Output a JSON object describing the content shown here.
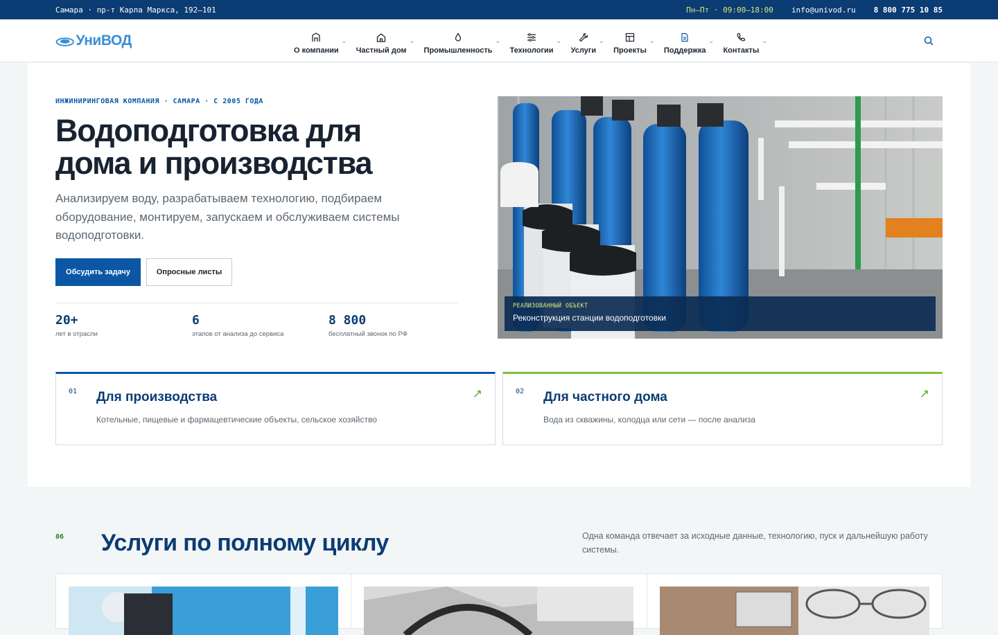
{
  "topbar": {
    "address": "Самара · пр-т Карла Маркса, 192–101",
    "hours": "Пн–Пт · 09:00–18:00",
    "email": "info@univod.ru",
    "phone": "8 800 775 10 85"
  },
  "logo": {
    "text": "УниВОД"
  },
  "nav": [
    {
      "label": "О компании",
      "icon": "building-icon"
    },
    {
      "label": "Частный дом",
      "icon": "house-icon"
    },
    {
      "label": "Промышленность",
      "icon": "droplet-icon"
    },
    {
      "label": "Технологии",
      "icon": "sliders-icon"
    },
    {
      "label": "Услуги",
      "icon": "wrench-icon"
    },
    {
      "label": "Проекты",
      "icon": "grid-icon"
    },
    {
      "label": "Поддержка",
      "icon": "document-icon"
    },
    {
      "label": "Контакты",
      "icon": "phone-icon"
    }
  ],
  "hero": {
    "eyebrow": "ИНЖИНИРИНГОВАЯ КОМПАНИЯ · САМАРА · С 2005 ГОДА",
    "title": "Водоподготовка для дома и производства",
    "lead": "Анализируем воду, разрабатываем технологию, подбираем оборудование, монтируем, запускаем и обслуживаем системы водоподготовки.",
    "primary_button": "Обсудить задачу",
    "secondary_button": "Опросные листы",
    "stats": [
      {
        "value": "20+",
        "caption": "лет в отрасли"
      },
      {
        "value": "6",
        "caption": "этапов от анализа до сервиса"
      },
      {
        "value": "8 800",
        "caption": "бесплатный звонок по РФ"
      }
    ],
    "photo": {
      "tag": "РЕАЛИЗОВАННЫЙ ОБЪЕКТ",
      "title": "Реконструкция станции водоподготовки"
    }
  },
  "cards": [
    {
      "index": "01",
      "title": "Для производства",
      "description": "Котельные, пищевые и фармацевтические объекты, сельское хозяйство",
      "arrow": "↗"
    },
    {
      "index": "02",
      "title": "Для частного дома",
      "description": "Вода из скважины, колодца или сети — после анализа",
      "arrow": "↗"
    }
  ],
  "services": {
    "number": "06",
    "title": "Услуги по полному циклу",
    "description": "Одна команда отвечает за исходные данные, технологию, пуск и дальнейшую работу системы."
  },
  "colors": {
    "brand": "#0b3c73",
    "accent": "#0b57a6",
    "green": "#7fbf3b",
    "topbar_highlight": "#d6e87a"
  }
}
